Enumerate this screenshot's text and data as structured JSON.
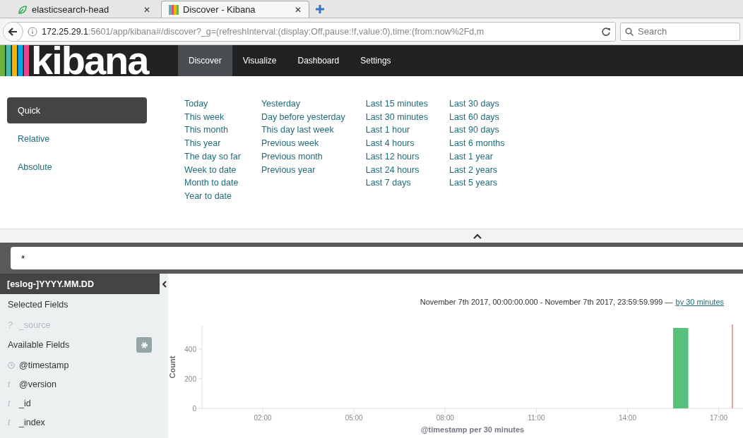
{
  "browser": {
    "tabs": [
      {
        "title": "elasticsearch-head",
        "close": "✕",
        "selected": false
      },
      {
        "title": "Discover - Kibana",
        "close": "✕",
        "selected": true
      }
    ],
    "url_host": "172.25.29.1",
    "url_rest": ":5601/app/kibana#/discover?_g=(refreshInterval:(display:Off,pause:!f,value:0),time:(from:now%2Fd,m",
    "search": {
      "placeholder": "Search"
    }
  },
  "navbar": {
    "logo": "kibana",
    "items": [
      {
        "label": "Discover",
        "selected": true
      },
      {
        "label": "Visualize",
        "selected": false
      },
      {
        "label": "Dashboard",
        "selected": false
      },
      {
        "label": "Settings",
        "selected": false
      }
    ]
  },
  "timepicker": {
    "modes": [
      {
        "label": "Quick",
        "selected": true
      },
      {
        "label": "Relative",
        "selected": false
      },
      {
        "label": "Absolute",
        "selected": false
      }
    ],
    "columns": [
      [
        "Today",
        "This week",
        "This month",
        "This year",
        "The day so far",
        "Week to date",
        "Month to date",
        "Year to date"
      ],
      [
        "Yesterday",
        "Day before yesterday",
        "This day last week",
        "Previous week",
        "Previous month",
        "Previous year"
      ],
      [
        "Last 15 minutes",
        "Last 30 minutes",
        "Last 1 hour",
        "Last 4 hours",
        "Last 12 hours",
        "Last 24 hours",
        "Last 7 days"
      ],
      [
        "Last 30 days",
        "Last 60 days",
        "Last 90 days",
        "Last 6 months",
        "Last 1 year",
        "Last 2 years",
        "Last 5 years"
      ]
    ]
  },
  "query": {
    "value": "*"
  },
  "sidebar": {
    "index_pattern": "[eslog-]YYYY.MM.DD",
    "selected_title": "Selected Fields",
    "selected_fields": [
      {
        "type": "?",
        "name": "_source"
      }
    ],
    "available_title": "Available Fields",
    "available_fields": [
      {
        "kind": "date",
        "name": "@timestamp"
      },
      {
        "kind": "string",
        "type": "t",
        "name": "@version"
      },
      {
        "kind": "string",
        "type": "t",
        "name": "_id"
      },
      {
        "kind": "string",
        "type": "t",
        "name": "_index"
      }
    ]
  },
  "histogram": {
    "range": "November 7th 2017, 00:00:00.000 - November 7th 2017, 23:59:59.999 —",
    "interval_link": "by 30 minutes",
    "chart_data": {
      "type": "bar",
      "xlabel": "@timestamp per 30 minutes",
      "ylabel": "Count",
      "x": [
        15.75
      ],
      "values": [
        543
      ],
      "xlim": [
        0,
        17.8
      ],
      "ylim": [
        0,
        557
      ],
      "xticks": [
        {
          "value": 2,
          "label": "02:00"
        },
        {
          "value": 5,
          "label": "05:00"
        },
        {
          "value": 8,
          "label": "08:00"
        },
        {
          "value": 11,
          "label": "11:00"
        },
        {
          "value": 14,
          "label": "14:00"
        },
        {
          "value": 17,
          "label": "17:00"
        }
      ],
      "yticks": [
        0,
        200,
        400
      ],
      "ref_lines": [
        {
          "axis": "x",
          "value": 17.45
        }
      ]
    }
  }
}
